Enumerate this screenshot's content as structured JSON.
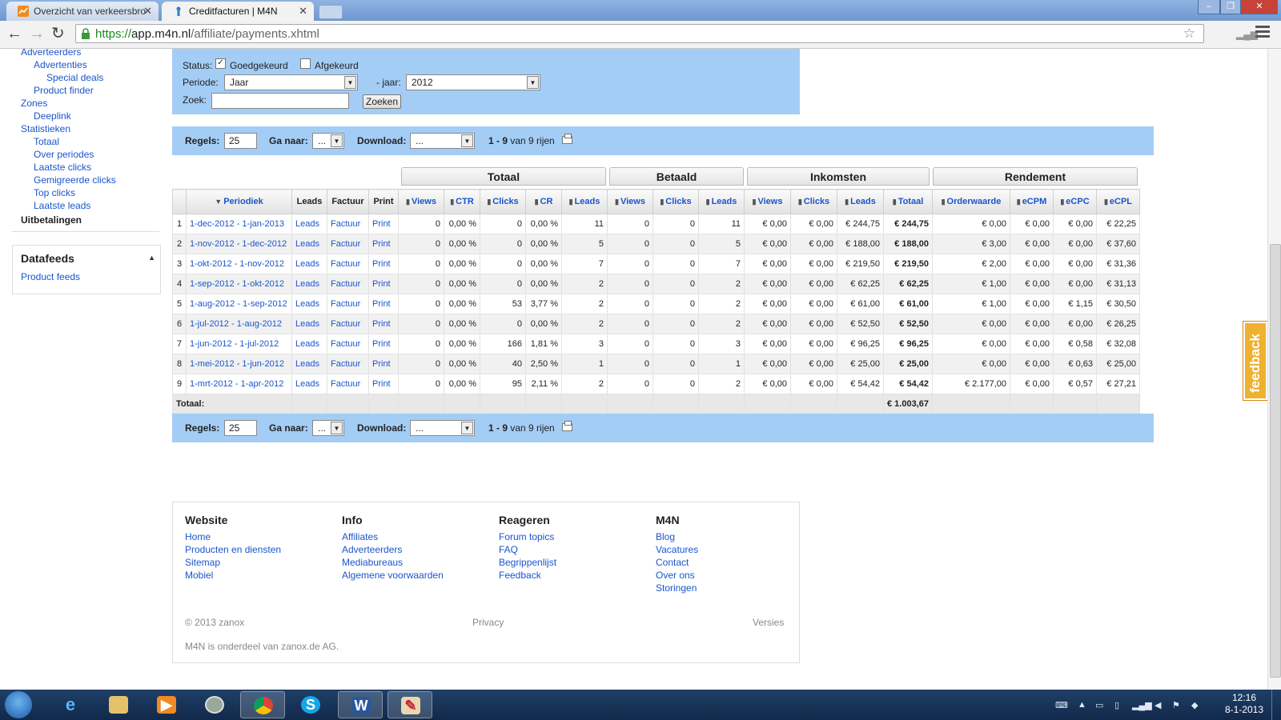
{
  "browser": {
    "tabs": [
      {
        "title": "Overzicht van verkeersbro",
        "active": false
      },
      {
        "title": "Creditfacturen | M4N",
        "active": true
      }
    ],
    "url_scheme": "https://",
    "url_host": "app.m4n.nl",
    "url_path": "/affiliate/payments.xhtml"
  },
  "sidebar": {
    "items": [
      {
        "label": "Adverteerders",
        "level": 0
      },
      {
        "label": "Advertenties",
        "level": 1
      },
      {
        "label": "Special deals",
        "level": 2
      },
      {
        "label": "Product finder",
        "level": 1
      },
      {
        "label": "Zones",
        "level": 0
      },
      {
        "label": "Deeplink",
        "level": 1
      },
      {
        "label": "Statistieken",
        "level": 0
      },
      {
        "label": "Totaal",
        "level": 1
      },
      {
        "label": "Over periodes",
        "level": 1
      },
      {
        "label": "Laatste clicks",
        "level": 1
      },
      {
        "label": "Gemigreerde clicks",
        "level": 1
      },
      {
        "label": "Top clicks",
        "level": 1
      },
      {
        "label": "Laatste leads",
        "level": 1
      }
    ],
    "active": "Uitbetalingen",
    "datafeeds": {
      "title": "Datafeeds",
      "link": "Product feeds"
    }
  },
  "filter": {
    "status_label": "Status:",
    "approved_label": "Goedgekeurd",
    "approved_checked": true,
    "rejected_label": "Afgekeurd",
    "rejected_checked": false,
    "period_label": "Periode:",
    "period_value": "Jaar",
    "year_label": "- jaar:",
    "year_value": "2012",
    "search_label": "Zoek:",
    "search_value": "",
    "search_button": "Zoeken"
  },
  "pager": {
    "rows_label": "Regels:",
    "rows_value": "25",
    "goto_label": "Ga naar:",
    "goto_value": "...",
    "download_label": "Download:",
    "download_value": "...",
    "range": "1 - 9",
    "of_text": "van 9 rijen"
  },
  "table": {
    "groups": [
      "Totaal",
      "Betaald",
      "Inkomsten",
      "Rendement"
    ],
    "headers": [
      "",
      "Periodiek",
      "Leads",
      "Factuur",
      "Print",
      "Views",
      "CTR",
      "Clicks",
      "CR",
      "Leads",
      "Views",
      "Clicks",
      "Leads",
      "Views",
      "Clicks",
      "Leads",
      "Totaal",
      "Orderwaarde",
      "eCPM",
      "eCPC",
      "eCPL"
    ],
    "rows": [
      [
        "1",
        "1-dec-2012 - 1-jan-2013",
        "Leads",
        "Factuur",
        "Print",
        "0",
        "0,00 %",
        "0",
        "0,00 %",
        "11",
        "0",
        "0",
        "11",
        "€ 0,00",
        "€ 0,00",
        "€ 244,75",
        "€ 244,75",
        "€ 0,00",
        "€ 0,00",
        "€ 0,00",
        "€ 22,25"
      ],
      [
        "2",
        "1-nov-2012 - 1-dec-2012",
        "Leads",
        "Factuur",
        "Print",
        "0",
        "0,00 %",
        "0",
        "0,00 %",
        "5",
        "0",
        "0",
        "5",
        "€ 0,00",
        "€ 0,00",
        "€ 188,00",
        "€ 188,00",
        "€ 3,00",
        "€ 0,00",
        "€ 0,00",
        "€ 37,60"
      ],
      [
        "3",
        "1-okt-2012 - 1-nov-2012",
        "Leads",
        "Factuur",
        "Print",
        "0",
        "0,00 %",
        "0",
        "0,00 %",
        "7",
        "0",
        "0",
        "7",
        "€ 0,00",
        "€ 0,00",
        "€ 219,50",
        "€ 219,50",
        "€ 2,00",
        "€ 0,00",
        "€ 0,00",
        "€ 31,36"
      ],
      [
        "4",
        "1-sep-2012 - 1-okt-2012",
        "Leads",
        "Factuur",
        "Print",
        "0",
        "0,00 %",
        "0",
        "0,00 %",
        "2",
        "0",
        "0",
        "2",
        "€ 0,00",
        "€ 0,00",
        "€ 62,25",
        "€ 62,25",
        "€ 1,00",
        "€ 0,00",
        "€ 0,00",
        "€ 31,13"
      ],
      [
        "5",
        "1-aug-2012 - 1-sep-2012",
        "Leads",
        "Factuur",
        "Print",
        "0",
        "0,00 %",
        "53",
        "3,77 %",
        "2",
        "0",
        "0",
        "2",
        "€ 0,00",
        "€ 0,00",
        "€ 61,00",
        "€ 61,00",
        "€ 1,00",
        "€ 0,00",
        "€ 1,15",
        "€ 30,50"
      ],
      [
        "6",
        "1-jul-2012 - 1-aug-2012",
        "Leads",
        "Factuur",
        "Print",
        "0",
        "0,00 %",
        "0",
        "0,00 %",
        "2",
        "0",
        "0",
        "2",
        "€ 0,00",
        "€ 0,00",
        "€ 52,50",
        "€ 52,50",
        "€ 0,00",
        "€ 0,00",
        "€ 0,00",
        "€ 26,25"
      ],
      [
        "7",
        "1-jun-2012 - 1-jul-2012",
        "Leads",
        "Factuur",
        "Print",
        "0",
        "0,00 %",
        "166",
        "1,81 %",
        "3",
        "0",
        "0",
        "3",
        "€ 0,00",
        "€ 0,00",
        "€ 96,25",
        "€ 96,25",
        "€ 0,00",
        "€ 0,00",
        "€ 0,58",
        "€ 32,08"
      ],
      [
        "8",
        "1-mei-2012 - 1-jun-2012",
        "Leads",
        "Factuur",
        "Print",
        "0",
        "0,00 %",
        "40",
        "2,50 %",
        "1",
        "0",
        "0",
        "1",
        "€ 0,00",
        "€ 0,00",
        "€ 25,00",
        "€ 25,00",
        "€ 0,00",
        "€ 0,00",
        "€ 0,63",
        "€ 25,00"
      ],
      [
        "9",
        "1-mrt-2012 - 1-apr-2012",
        "Leads",
        "Factuur",
        "Print",
        "0",
        "0,00 %",
        "95",
        "2,11 %",
        "2",
        "0",
        "0",
        "2",
        "€ 0,00",
        "€ 0,00",
        "€ 54,42",
        "€ 54,42",
        "€ 2.177,00",
        "€ 0,00",
        "€ 0,57",
        "€ 27,21"
      ]
    ],
    "total_label": "Totaal:",
    "total_value": "€ 1.003,67"
  },
  "footer": {
    "columns": [
      {
        "title": "Website",
        "links": [
          "Home",
          "Producten en diensten",
          "Sitemap",
          "Mobiel"
        ]
      },
      {
        "title": "Info",
        "links": [
          "Affiliates",
          "Adverteerders",
          "Mediabureaus",
          "Algemene voorwaarden"
        ]
      },
      {
        "title": "Reageren",
        "links": [
          "Forum topics",
          "FAQ",
          "Begrippenlijst",
          "Feedback"
        ]
      },
      {
        "title": "M4N",
        "links": [
          "Blog",
          "Vacatures",
          "Contact",
          "Over ons",
          "Storingen"
        ]
      }
    ],
    "copyright": "© 2013  zanox",
    "privacy": "Privacy",
    "versions": "Versies",
    "note": "M4N is onderdeel van zanox.de AG."
  },
  "feedback_tab": "feedback",
  "taskbar": {
    "time": "12:16",
    "date": "8-1-2013",
    "apps": [
      "internet-explorer",
      "file-explorer",
      "media-player",
      "app-circle",
      "chrome",
      "skype",
      "word",
      "paint"
    ]
  },
  "colors": {
    "filter_bg": "#a4cdf6",
    "link": "#1a55cc",
    "feedback": "#f0b030"
  }
}
